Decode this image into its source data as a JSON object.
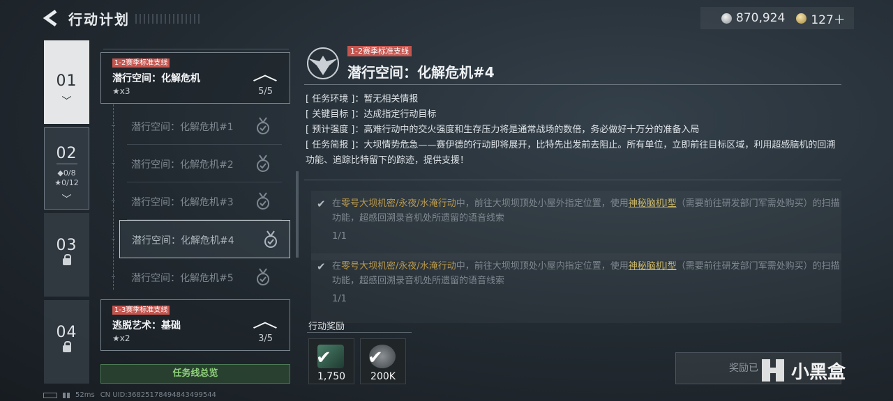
{
  "header": {
    "title": "行动计划",
    "currency": [
      {
        "icon": "silver-coin-icon",
        "value": "870,924"
      },
      {
        "icon": "gold-coin-icon",
        "value": "127＋"
      }
    ]
  },
  "chapters": [
    {
      "num": "01",
      "state": "selected"
    },
    {
      "num": "02",
      "diamonds": "◆0/8",
      "stars": "★0/12"
    },
    {
      "num": "03",
      "state": "locked"
    },
    {
      "num": "04",
      "state": "locked"
    }
  ],
  "groups": [
    {
      "tag": "1-2赛季标准支线",
      "name": "潜行空间：化解危机",
      "stars": "★x3",
      "progress": "5/5"
    },
    {
      "tag": "1-3赛季标准支线",
      "name": "逃脱艺术：基础",
      "stars": "★x2",
      "progress": "3/5"
    }
  ],
  "missions": [
    "潜行空间：化解危机#1",
    "潜行空间：化解危机#2",
    "潜行空间：化解危机#3",
    "潜行空间：化解危机#4",
    "潜行空间：化解危机#5"
  ],
  "overview_button": "任务线总览",
  "status_bar": {
    "ping": "52ms",
    "uid": "CN UID:36825178494843499544"
  },
  "detail": {
    "tag": "1-2赛季标准支线",
    "title": "潜行空间：化解危机#4",
    "info": [
      {
        "key": "[ 任务环境 ]：",
        "value": "暂无相关情报"
      },
      {
        "key": "[ 关键目标 ]：",
        "value": "达成指定行动目标"
      },
      {
        "key": "[ 预计强度 ]：",
        "value": "高难行动中的交火强度和生存压力将是通常战场的数倍，务必做好十万分的准备入局"
      },
      {
        "key": "[ 任务简报 ]：",
        "value": "大坝情势危急——赛伊德的行动即将展开，比特先出发前去阻止。所有单位，立即前往目标区域，利用超感脑机的回溯功能、追踪比特留下的踪迹，提供支援！"
      }
    ],
    "objectives": [
      {
        "pre": "在",
        "highlight": "零号大坝机密/永夜/水淹行动",
        "mid": "中，前往大坝坝顶处小屋外指定位置，使用",
        "item": "神秘脑机Ⅰ型",
        "post": "（需要前往研发部门军需处购买）的扫描功能，超感回溯录音机处所遗留的语音线索",
        "progress": "1/1"
      },
      {
        "pre": "在",
        "highlight": "零号大坝机密/永夜/水淹行动",
        "mid": "中，前往大坝坝顶处小屋内指定位置，使用",
        "item": "神秘脑机Ⅰ型",
        "post": "（需要前往研发部门军需处购买）的扫描功能，超感回溯录音机处所遗留的语音线索",
        "progress": "1/1"
      }
    ],
    "reward_label": "行动奖励",
    "rewards": [
      {
        "icon": "exp-card-icon",
        "amount": "1,750"
      },
      {
        "icon": "coin-reward-icon",
        "amount": "200K"
      }
    ],
    "claim_button": "奖励已"
  },
  "watermark": "小黑盒",
  "colors": {
    "accent_red": "#c4554f",
    "accent_green": "#8fd27a",
    "highlight_gold": "#bb9a4d"
  }
}
